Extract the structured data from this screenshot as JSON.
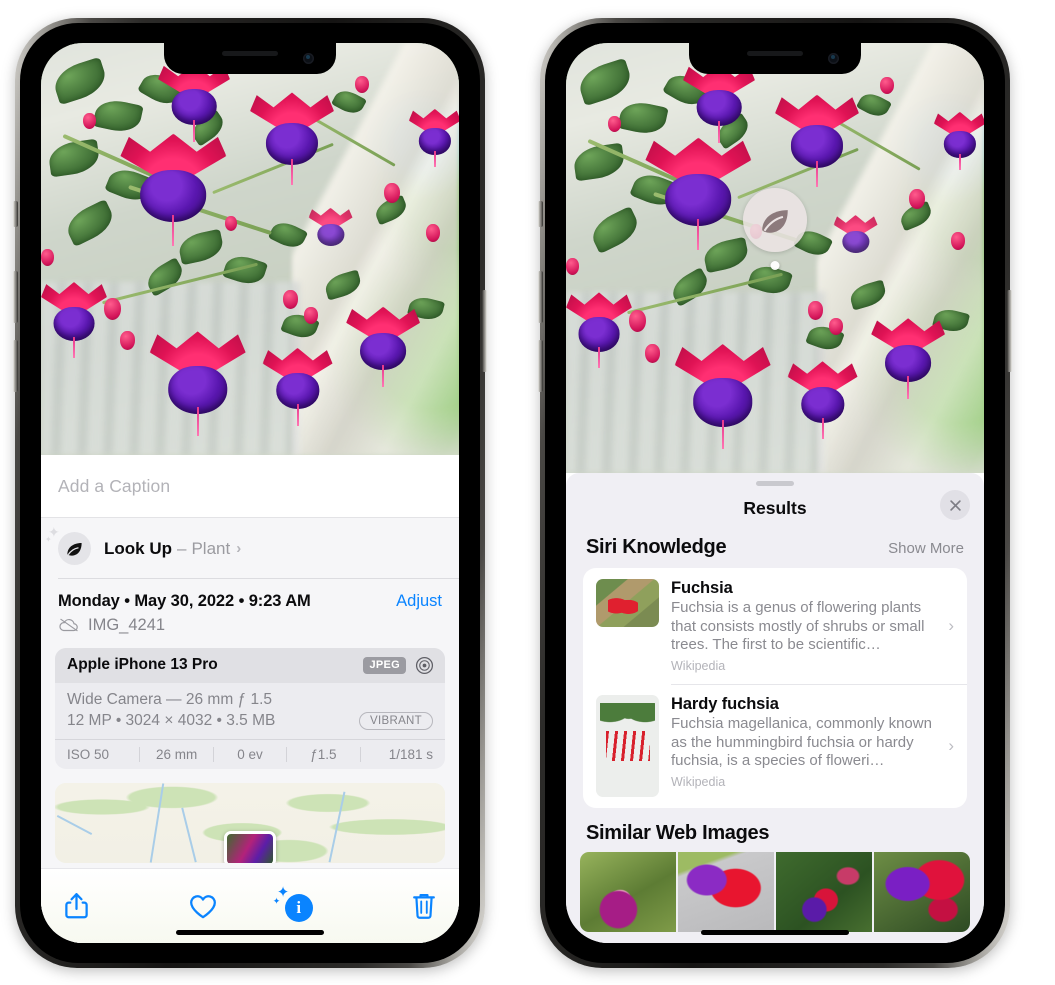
{
  "left_phone": {
    "caption_field": {
      "placeholder": "Add a Caption",
      "value": ""
    },
    "look_up": {
      "label": "Look Up",
      "dash": "–",
      "subject": "Plant",
      "chevron": "›",
      "icon": "leaf-icon"
    },
    "date_line": "Monday • May 30, 2022 • 9:23 AM",
    "adjust_label": "Adjust",
    "file_name": "IMG_4241",
    "cloud_icon": "icloud-slash-icon",
    "camera": {
      "model": "Apple iPhone 13 Pro",
      "format_badge": "JPEG",
      "aperture_icon": "aperture-icon",
      "lens_line": "Wide Camera — 26 mm ƒ 1.5",
      "size_line": "12 MP • 3024 × 4032 • 3.5 MB",
      "style_badge": "VIBRANT",
      "exif": [
        "ISO 50",
        "26 mm",
        "0 ev",
        "ƒ1.5",
        "1/181 s"
      ]
    },
    "toolbar": [
      {
        "name": "share-button",
        "icon": "share-icon"
      },
      {
        "name": "favorite-button",
        "icon": "heart-icon"
      },
      {
        "name": "info-button",
        "icon": "info-sparkle-icon",
        "glyph": "i"
      },
      {
        "name": "delete-button",
        "icon": "trash-icon"
      }
    ],
    "accent": "#0A84FF"
  },
  "right_phone": {
    "visual_lookup_badge": {
      "icon": "leaf-icon"
    },
    "panel": {
      "title": "Results",
      "close_icon": "close-icon",
      "grabber": "drag-handle"
    },
    "siri_knowledge": {
      "heading": "Siri Knowledge",
      "show_more": "Show More",
      "items": [
        {
          "title": "Fuchsia",
          "description": "Fuchsia is a genus of flowering plants that consists mostly of shrubs or small trees. The first to be scientific…",
          "source": "Wikipedia",
          "thumb": "fuchsia-red-flowers-thumb",
          "chevron": "›"
        },
        {
          "title": "Hardy fuchsia",
          "description": "Fuchsia magellanica, commonly known as the hummingbird fuchsia or hardy fuchsia, is a species of floweri…",
          "source": "Wikipedia",
          "thumb": "hardy-fuchsia-specimen-thumb",
          "chevron": "›"
        }
      ]
    },
    "similar_web_images": {
      "heading": "Similar Web Images",
      "thumbs": [
        "fuchsia-pink-white",
        "fuchsia-red-closeup",
        "fuchsia-shrub",
        "fuchsia-purple-red"
      ]
    }
  },
  "photo": {
    "subject": "Fuchsia flowers in hanging basket",
    "colors": {
      "petal_pink": "#FF2F72",
      "corolla_purple": "#5A17B0",
      "leaf_green": "#3C6B33"
    }
  }
}
